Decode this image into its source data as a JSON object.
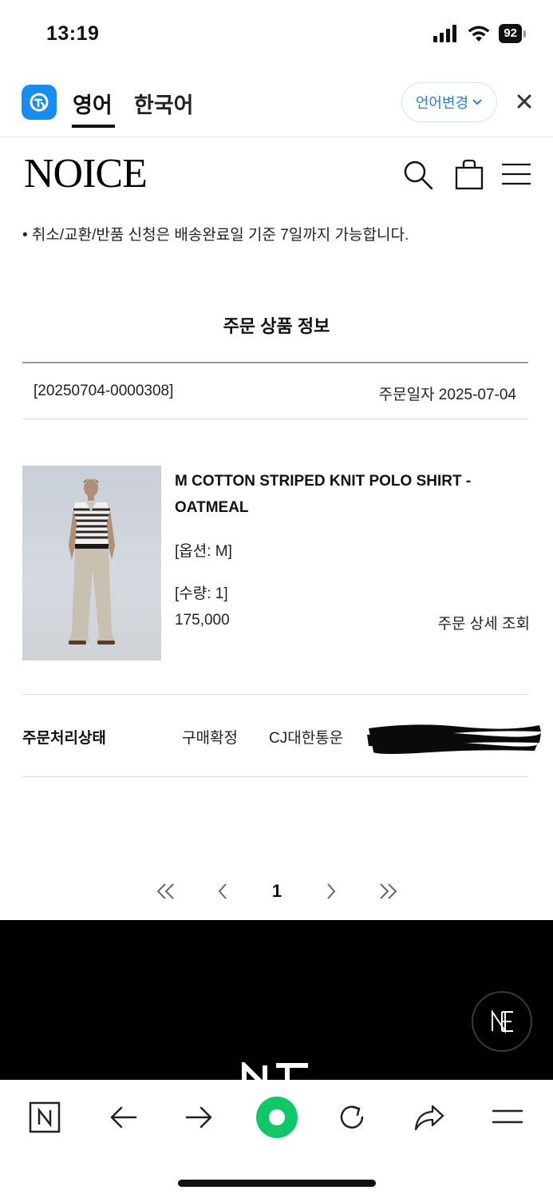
{
  "status_bar": {
    "time": "13:19",
    "battery": "92"
  },
  "translate_bar": {
    "tabs": [
      "영어",
      "한국어"
    ],
    "active_tab": "영어",
    "change_language_label": "언어변경",
    "accent_color": "#1a8cf0"
  },
  "header": {
    "brand": "NOICE",
    "icons": [
      "search-icon",
      "bag-icon",
      "menu-icon"
    ]
  },
  "notice": "• 취소/교환/반품 신청은 배송완료일 기준 7일까지 가능합니다.",
  "section_title": "주문 상품 정보",
  "order": {
    "number": "[20250704-0000308]",
    "date_label": "주문일자 2025-07-04"
  },
  "product": {
    "name": "M COTTON STRIPED KNIT POLO SHIRT - OATMEAL",
    "option": "[옵션: M]",
    "quantity": "[수량: 1]",
    "price": "175,000",
    "detail_link": "주문 상세 조회"
  },
  "order_status": {
    "label": "주문처리상태",
    "value": "구매확정",
    "carrier": "CJ대한통운"
  },
  "pagination": {
    "first": "«",
    "prev": "‹",
    "current": "1",
    "next": "›",
    "last": "»"
  },
  "browser_toolbar": {
    "buttons": [
      "naver-icon",
      "back-arrow-icon",
      "forward-arrow-icon",
      "green-dot-icon",
      "reload-icon",
      "share-icon",
      "menu-icon"
    ],
    "green": "#12c76a"
  }
}
